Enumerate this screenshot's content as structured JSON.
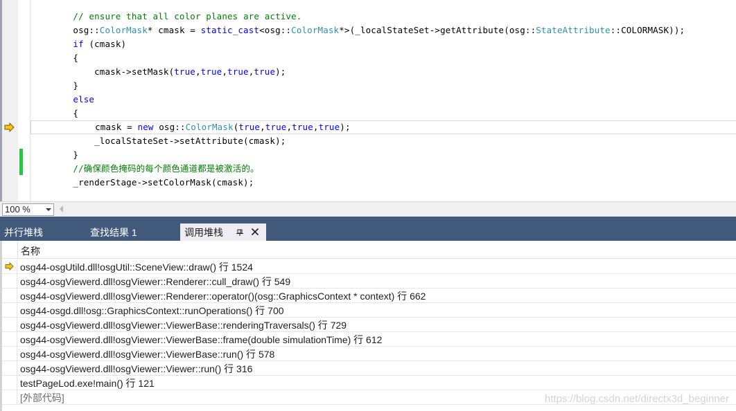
{
  "editor": {
    "code_lines": [
      [
        {
          "t": "        ",
          "c": "plain"
        },
        {
          "t": "// ensure that all color planes are active.",
          "c": "comment"
        }
      ],
      [
        {
          "t": "        osg::",
          "c": "plain"
        },
        {
          "t": "ColorMask",
          "c": "type"
        },
        {
          "t": "* cmask = ",
          "c": "plain"
        },
        {
          "t": "static_cast",
          "c": "kw"
        },
        {
          "t": "<osg::",
          "c": "plain"
        },
        {
          "t": "ColorMask",
          "c": "type"
        },
        {
          "t": "*>(_localStateSet->getAttribute(osg::",
          "c": "plain"
        },
        {
          "t": "StateAttribute",
          "c": "type"
        },
        {
          "t": "::COLORMASK));",
          "c": "plain"
        }
      ],
      [
        {
          "t": "        ",
          "c": "plain"
        },
        {
          "t": "if",
          "c": "kw"
        },
        {
          "t": " (cmask)",
          "c": "plain"
        }
      ],
      [
        {
          "t": "        {",
          "c": "plain"
        }
      ],
      [
        {
          "t": "            cmask->setMask(",
          "c": "plain"
        },
        {
          "t": "true",
          "c": "kw"
        },
        {
          "t": ",",
          "c": "plain"
        },
        {
          "t": "true",
          "c": "kw"
        },
        {
          "t": ",",
          "c": "plain"
        },
        {
          "t": "true",
          "c": "kw"
        },
        {
          "t": ",",
          "c": "plain"
        },
        {
          "t": "true",
          "c": "kw"
        },
        {
          "t": ");",
          "c": "plain"
        }
      ],
      [
        {
          "t": "        }",
          "c": "plain"
        }
      ],
      [
        {
          "t": "        ",
          "c": "plain"
        },
        {
          "t": "else",
          "c": "kw"
        }
      ],
      [
        {
          "t": "        {",
          "c": "plain"
        }
      ],
      [
        {
          "t": "            cmask = ",
          "c": "plain"
        },
        {
          "t": "new",
          "c": "kw"
        },
        {
          "t": " osg::",
          "c": "plain"
        },
        {
          "t": "ColorMask",
          "c": "type"
        },
        {
          "t": "(",
          "c": "plain"
        },
        {
          "t": "true",
          "c": "kw"
        },
        {
          "t": ",",
          "c": "plain"
        },
        {
          "t": "true",
          "c": "kw"
        },
        {
          "t": ",",
          "c": "plain"
        },
        {
          "t": "true",
          "c": "kw"
        },
        {
          "t": ",",
          "c": "plain"
        },
        {
          "t": "true",
          "c": "kw"
        },
        {
          "t": ");",
          "c": "plain"
        }
      ],
      [
        {
          "t": "            _localStateSet->setAttribute(cmask);",
          "c": "plain"
        }
      ],
      [
        {
          "t": "        }",
          "c": "plain"
        }
      ],
      [
        {
          "t": "        ",
          "c": "plain"
        },
        {
          "t": "//确保颜色掩码的每个颜色通道都是被激活的。",
          "c": "comment"
        }
      ],
      [
        {
          "t": "        _renderStage->setColorMask(cmask);",
          "c": "plain"
        }
      ]
    ],
    "current_line_index": 8,
    "changed_line_indices": [
      10,
      11
    ],
    "zoom": "100 %"
  },
  "colors": {
    "keyword": "#0000ff",
    "type": "#2b91af",
    "comment": "#008000",
    "tabbar": "#425a7c",
    "arrow": "#f5c518",
    "changed": "#27c445"
  },
  "tool_tabs": [
    {
      "label": "并行堆栈",
      "active": false
    },
    {
      "label": "查找结果 1",
      "active": false
    },
    {
      "label": "调用堆栈",
      "active": true
    }
  ],
  "call_stack": {
    "header": "名称",
    "current_row_index": 0,
    "rows": [
      {
        "text": "osg44-osgUtild.dll!osgUtil::SceneView::draw() 行 1524"
      },
      {
        "text": "osg44-osgViewerd.dll!osgViewer::Renderer::cull_draw() 行 549"
      },
      {
        "text": "osg44-osgViewerd.dll!osgViewer::Renderer::operator()(osg::GraphicsContext * context) 行 662"
      },
      {
        "text": "osg44-osgd.dll!osg::GraphicsContext::runOperations() 行 700"
      },
      {
        "text": "osg44-osgViewerd.dll!osgViewer::ViewerBase::renderingTraversals() 行 729"
      },
      {
        "text": "osg44-osgViewerd.dll!osgViewer::ViewerBase::frame(double simulationTime) 行 612"
      },
      {
        "text": "osg44-osgViewerd.dll!osgViewer::ViewerBase::run() 行 578"
      },
      {
        "text": "osg44-osgViewerd.dll!osgViewer::Viewer::run() 行 316"
      },
      {
        "text": "testPageLod.exe!main() 行 121"
      },
      {
        "text": "[外部代码]",
        "external": true
      }
    ]
  },
  "watermark": "https://blog.csdn.net/directx3d_beginner"
}
